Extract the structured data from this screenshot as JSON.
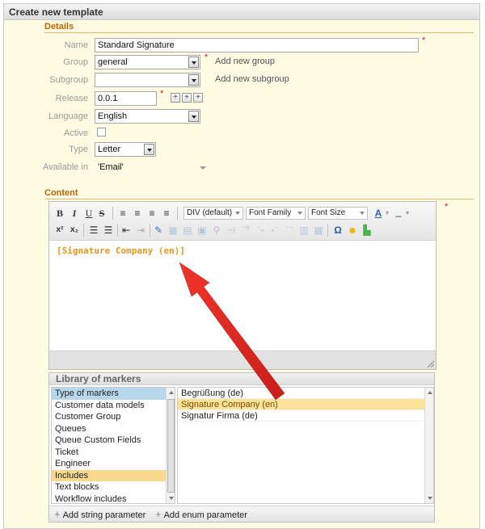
{
  "panel": {
    "title": "Create new template"
  },
  "details": {
    "section_title": "Details",
    "name": {
      "label": "Name",
      "value": "Standard Signature"
    },
    "group": {
      "label": "Group",
      "value": "general",
      "link": "Add new group"
    },
    "subgroup": {
      "label": "Subgroup",
      "value": "",
      "link": "Add new subgroup"
    },
    "release": {
      "label": "Release",
      "value": "0.0.1"
    },
    "language": {
      "label": "Language",
      "value": "English"
    },
    "active": {
      "label": "Active"
    },
    "type": {
      "label": "Type",
      "value": "Letter"
    },
    "available_in": {
      "label": "Available in",
      "value": "'Email'"
    }
  },
  "content": {
    "section_title": "Content",
    "toolbar": {
      "format_combo": "DIV (default)",
      "font_family_combo": "Font Family",
      "font_size_combo": "Font Size"
    },
    "editor_text": "[Signature Company (en)]"
  },
  "library": {
    "title": "Library of markers",
    "left_items": [
      "Type of markers",
      "Customer data models",
      "Customer Group",
      "Queues",
      "Queue Custom Fields",
      "Ticket",
      "Engineer",
      "Includes",
      "Text blocks",
      "Workflow includes"
    ],
    "right_items": [
      "Begrüßung (de)",
      "Signature Company (en)",
      "Signatur Firma (de)"
    ],
    "add_string": "Add string parameter",
    "add_enum": "Add enum parameter"
  },
  "colors": {
    "accent": "#b96600",
    "required": "#dd1122",
    "selected_marker": "#f9d98d",
    "arrow": "#e8211c"
  }
}
